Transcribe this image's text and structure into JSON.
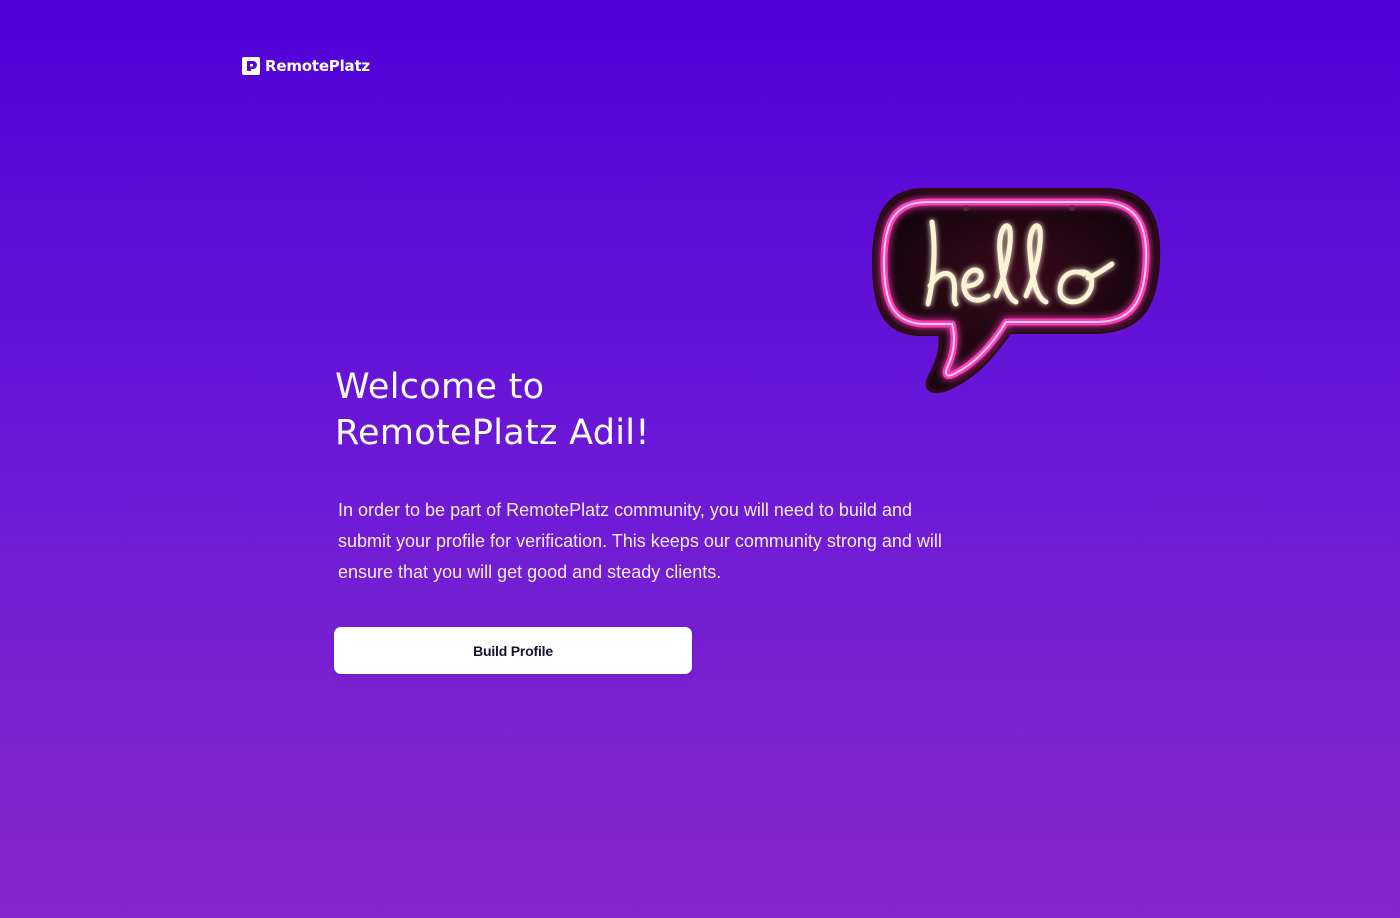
{
  "brand": {
    "name": "RemotePlatz",
    "logo_icon": "remoteplatz-logo-icon"
  },
  "hero_image": {
    "icon": "hello-neon-sign-icon",
    "sign_text": "hello"
  },
  "welcome": {
    "heading_line1": "Welcome to",
    "heading_line2": "RemotePlatz Adil!",
    "body_line1": "In order to be part of RemotePlatz community, you will need to build and",
    "body_line2": "submit your profile for verification. This keeps our community strong and will",
    "body_line3": "ensure that you will get good and steady clients."
  },
  "actions": {
    "build_profile_label": "Build Profile"
  },
  "colors": {
    "background_top": "#5000d8",
    "background_bottom": "#8526cf",
    "neon_pink": "#ff3db8",
    "neon_warm": "#fff3d6",
    "button_background": "#ffffff",
    "button_text": "#1a1030"
  }
}
